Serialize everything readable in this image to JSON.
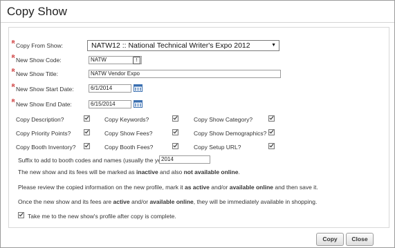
{
  "dialog": {
    "title": "Copy Show"
  },
  "form": {
    "required_mark": "R",
    "copy_from": {
      "label": "Copy From Show:",
      "value": "NATW12 :: National Technical Writer's Expo 2012"
    },
    "new_code": {
      "label": "New Show Code:",
      "value": "NATW"
    },
    "new_title": {
      "label": "New Show Title:",
      "value": "NATW Vendor Expo"
    },
    "start_date": {
      "label": "New Show Start Date:",
      "value": "6/1/2014"
    },
    "end_date": {
      "label": "New Show End Date:",
      "value": "6/15/2014"
    }
  },
  "options": [
    {
      "label": "Copy Description?",
      "checked": true
    },
    {
      "label": "Copy Keywords?",
      "checked": true
    },
    {
      "label": "Copy Show Category?",
      "checked": true
    },
    {
      "label": "Copy Priority Points?",
      "checked": true
    },
    {
      "label": "Copy Show Fees?",
      "checked": true
    },
    {
      "label": "Copy Show Demographics?",
      "checked": true
    },
    {
      "label": "Copy Booth Inventory?",
      "checked": true
    },
    {
      "label": "Copy Booth Fees?",
      "checked": true
    },
    {
      "label": "Copy Setup URL?",
      "checked": true
    }
  ],
  "suffix": {
    "label": "Suffix to add to booth codes and names (usually the year):",
    "value": "2014"
  },
  "notes": {
    "n1_a": "The new show and its fees will be marked as ",
    "n1_b": "inactive",
    "n1_c": " and also ",
    "n1_d": "not available online",
    "n1_e": ".",
    "n2_a": "Please review the copied information on the new profile, mark it ",
    "n2_b": "as active",
    "n2_c": " and/or ",
    "n2_d": "available online",
    "n2_e": " and then save it.",
    "n3_a": "Once the new show and its fees are ",
    "n3_b": "active",
    "n3_c": " and/or ",
    "n3_d": "available online",
    "n3_e": ", they will be immediately available in shopping."
  },
  "take_me": {
    "label": "Take me to the new show's profile after copy is complete.",
    "checked": true
  },
  "buttons": {
    "copy": "Copy",
    "close": "Close"
  },
  "icons": {
    "dropdown": "chevron-down-icon",
    "calendar": "calendar-icon",
    "lookup": "lookup-icon"
  }
}
